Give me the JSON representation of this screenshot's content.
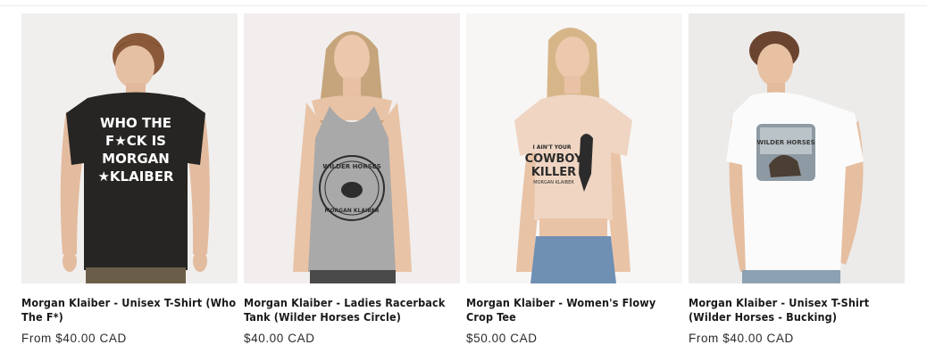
{
  "products": [
    {
      "title": "Morgan Klaiber - Unisex T-Shirt (Who The F*)",
      "price": "From $40.00 CAD",
      "print_lines": [
        "WHO THE",
        "F★CK IS",
        "MORGAN",
        "★KLAIBER"
      ],
      "bg": "#f1efee"
    },
    {
      "title": "Morgan Klaiber - Ladies Racerback Tank (Wilder Horses Circle)",
      "price": "$40.00 CAD",
      "print_lines": [
        "WILDER HORSES",
        "MORGAN KLAIBER"
      ],
      "bg": "#f1eeed"
    },
    {
      "title": "Morgan Klaiber - Women's Flowy Crop Tee",
      "price": "$50.00 CAD",
      "print_lines": [
        "I AIN'T YOUR",
        "COWBOY",
        "KILLER",
        "MORGAN KLAIBER"
      ],
      "bg": "#f7f6f5"
    },
    {
      "title": "Morgan Klaiber - Unisex T-Shirt (Wilder Horses - Bucking)",
      "price": "From $40.00 CAD",
      "print_lines": [
        "WILDER HORSES"
      ],
      "bg": "#ecebea"
    }
  ],
  "colors": {
    "shirt_black": "#262523",
    "tank_gray": "#a9a9a9",
    "crop_peach": "#efd5c2",
    "shirt_white": "#fbfbfb",
    "skin": "#e9c3a6"
  }
}
